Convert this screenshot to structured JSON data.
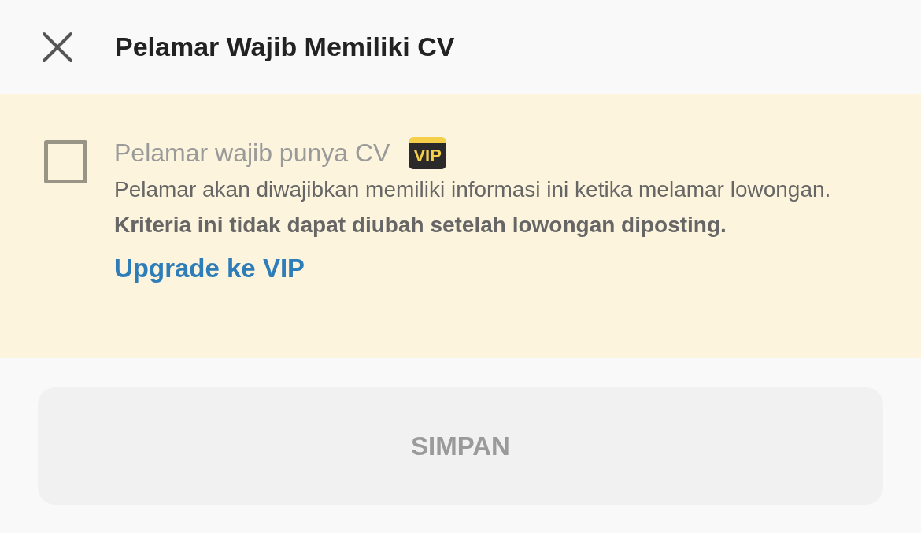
{
  "header": {
    "title": "Pelamar Wajib Memiliki CV"
  },
  "option": {
    "label": "Pelamar wajib punya CV",
    "badge": "VIP",
    "checked": false,
    "disabled": true,
    "description": "Pelamar akan diwajibkan memiliki informasi ini ketika melamar lowongan. **Kriteria ini tidak dapat diubah setelah lowongan diposting.**",
    "link": "Upgrade ke VIP"
  },
  "button": {
    "label": "SIMPAN",
    "disabled": true
  }
}
